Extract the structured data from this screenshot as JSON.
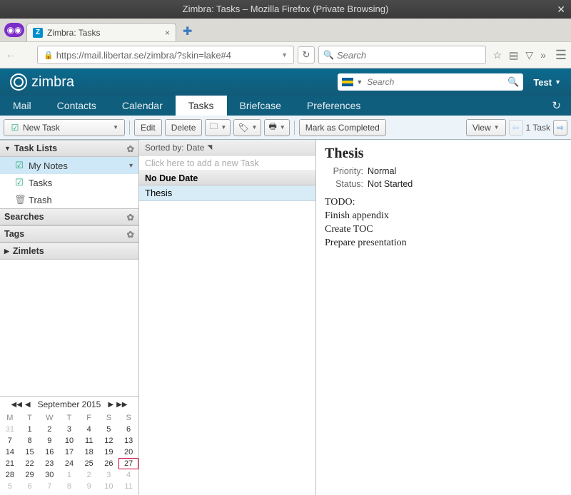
{
  "window": {
    "title": "Zimbra: Tasks – Mozilla Firefox (Private Browsing)"
  },
  "browser": {
    "tab_title": "Zimbra: Tasks",
    "url": "https://mail.libertar.se/zimbra/?skin=lake#4",
    "search_placeholder": "Search"
  },
  "app": {
    "name": "zimbra",
    "header_search_placeholder": "Search",
    "user": "Test"
  },
  "nav": [
    "Mail",
    "Contacts",
    "Calendar",
    "Tasks",
    "Briefcase",
    "Preferences"
  ],
  "nav_active": "Tasks",
  "toolbar": {
    "new_task": "New Task",
    "edit": "Edit",
    "delete": "Delete",
    "mark_completed": "Mark as Completed",
    "view": "View",
    "task_count": "1 Task"
  },
  "sidebar": {
    "task_lists": "Task Lists",
    "items": [
      {
        "label": "My Notes",
        "selected": true
      },
      {
        "label": "Tasks",
        "selected": false
      },
      {
        "label": "Trash",
        "selected": false
      }
    ],
    "searches": "Searches",
    "tags": "Tags",
    "zimlets": "Zimlets"
  },
  "minical": {
    "month": "September 2015",
    "dow": [
      "M",
      "T",
      "W",
      "T",
      "F",
      "S",
      "S"
    ],
    "weeks": [
      [
        {
          "d": 31,
          "dim": true
        },
        {
          "d": 1
        },
        {
          "d": 2
        },
        {
          "d": 3
        },
        {
          "d": 4
        },
        {
          "d": 5
        },
        {
          "d": 6
        }
      ],
      [
        {
          "d": 7
        },
        {
          "d": 8
        },
        {
          "d": 9
        },
        {
          "d": 10
        },
        {
          "d": 11
        },
        {
          "d": 12
        },
        {
          "d": 13
        }
      ],
      [
        {
          "d": 14
        },
        {
          "d": 15
        },
        {
          "d": 16
        },
        {
          "d": 17
        },
        {
          "d": 18
        },
        {
          "d": 19
        },
        {
          "d": 20
        }
      ],
      [
        {
          "d": 21
        },
        {
          "d": 22
        },
        {
          "d": 23
        },
        {
          "d": 24
        },
        {
          "d": 25
        },
        {
          "d": 26
        },
        {
          "d": 27,
          "today": true
        }
      ],
      [
        {
          "d": 28
        },
        {
          "d": 29
        },
        {
          "d": 30
        },
        {
          "d": 1,
          "dim": true
        },
        {
          "d": 2,
          "dim": true
        },
        {
          "d": 3,
          "dim": true
        },
        {
          "d": 4,
          "dim": true
        }
      ],
      [
        {
          "d": 5,
          "dim": true
        },
        {
          "d": 6,
          "dim": true
        },
        {
          "d": 7,
          "dim": true
        },
        {
          "d": 8,
          "dim": true
        },
        {
          "d": 9,
          "dim": true
        },
        {
          "d": 10,
          "dim": true
        },
        {
          "d": 11,
          "dim": true
        }
      ]
    ]
  },
  "list": {
    "sort_label": "Sorted by: Date",
    "add_hint": "Click here to add a new Task",
    "group": "No Due Date",
    "tasks": [
      {
        "title": "Thesis"
      }
    ]
  },
  "detail": {
    "title": "Thesis",
    "priority_label": "Priority:",
    "priority_value": "Normal",
    "status_label": "Status:",
    "status_value": "Not Started",
    "body": "TODO:\nFinish appendix\nCreate TOC\nPrepare presentation"
  }
}
